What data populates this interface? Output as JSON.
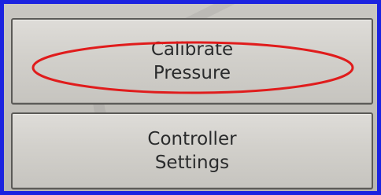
{
  "buttons": [
    {
      "label": "Calibrate\nPressure",
      "highlighted": true
    },
    {
      "label": "Controller\nSettings",
      "highlighted": false
    }
  ],
  "colors": {
    "frame": "#1b23e0",
    "highlight_ring": "#e01c1c",
    "button_face": "#d2d0cb",
    "text": "#2a2b2c"
  }
}
